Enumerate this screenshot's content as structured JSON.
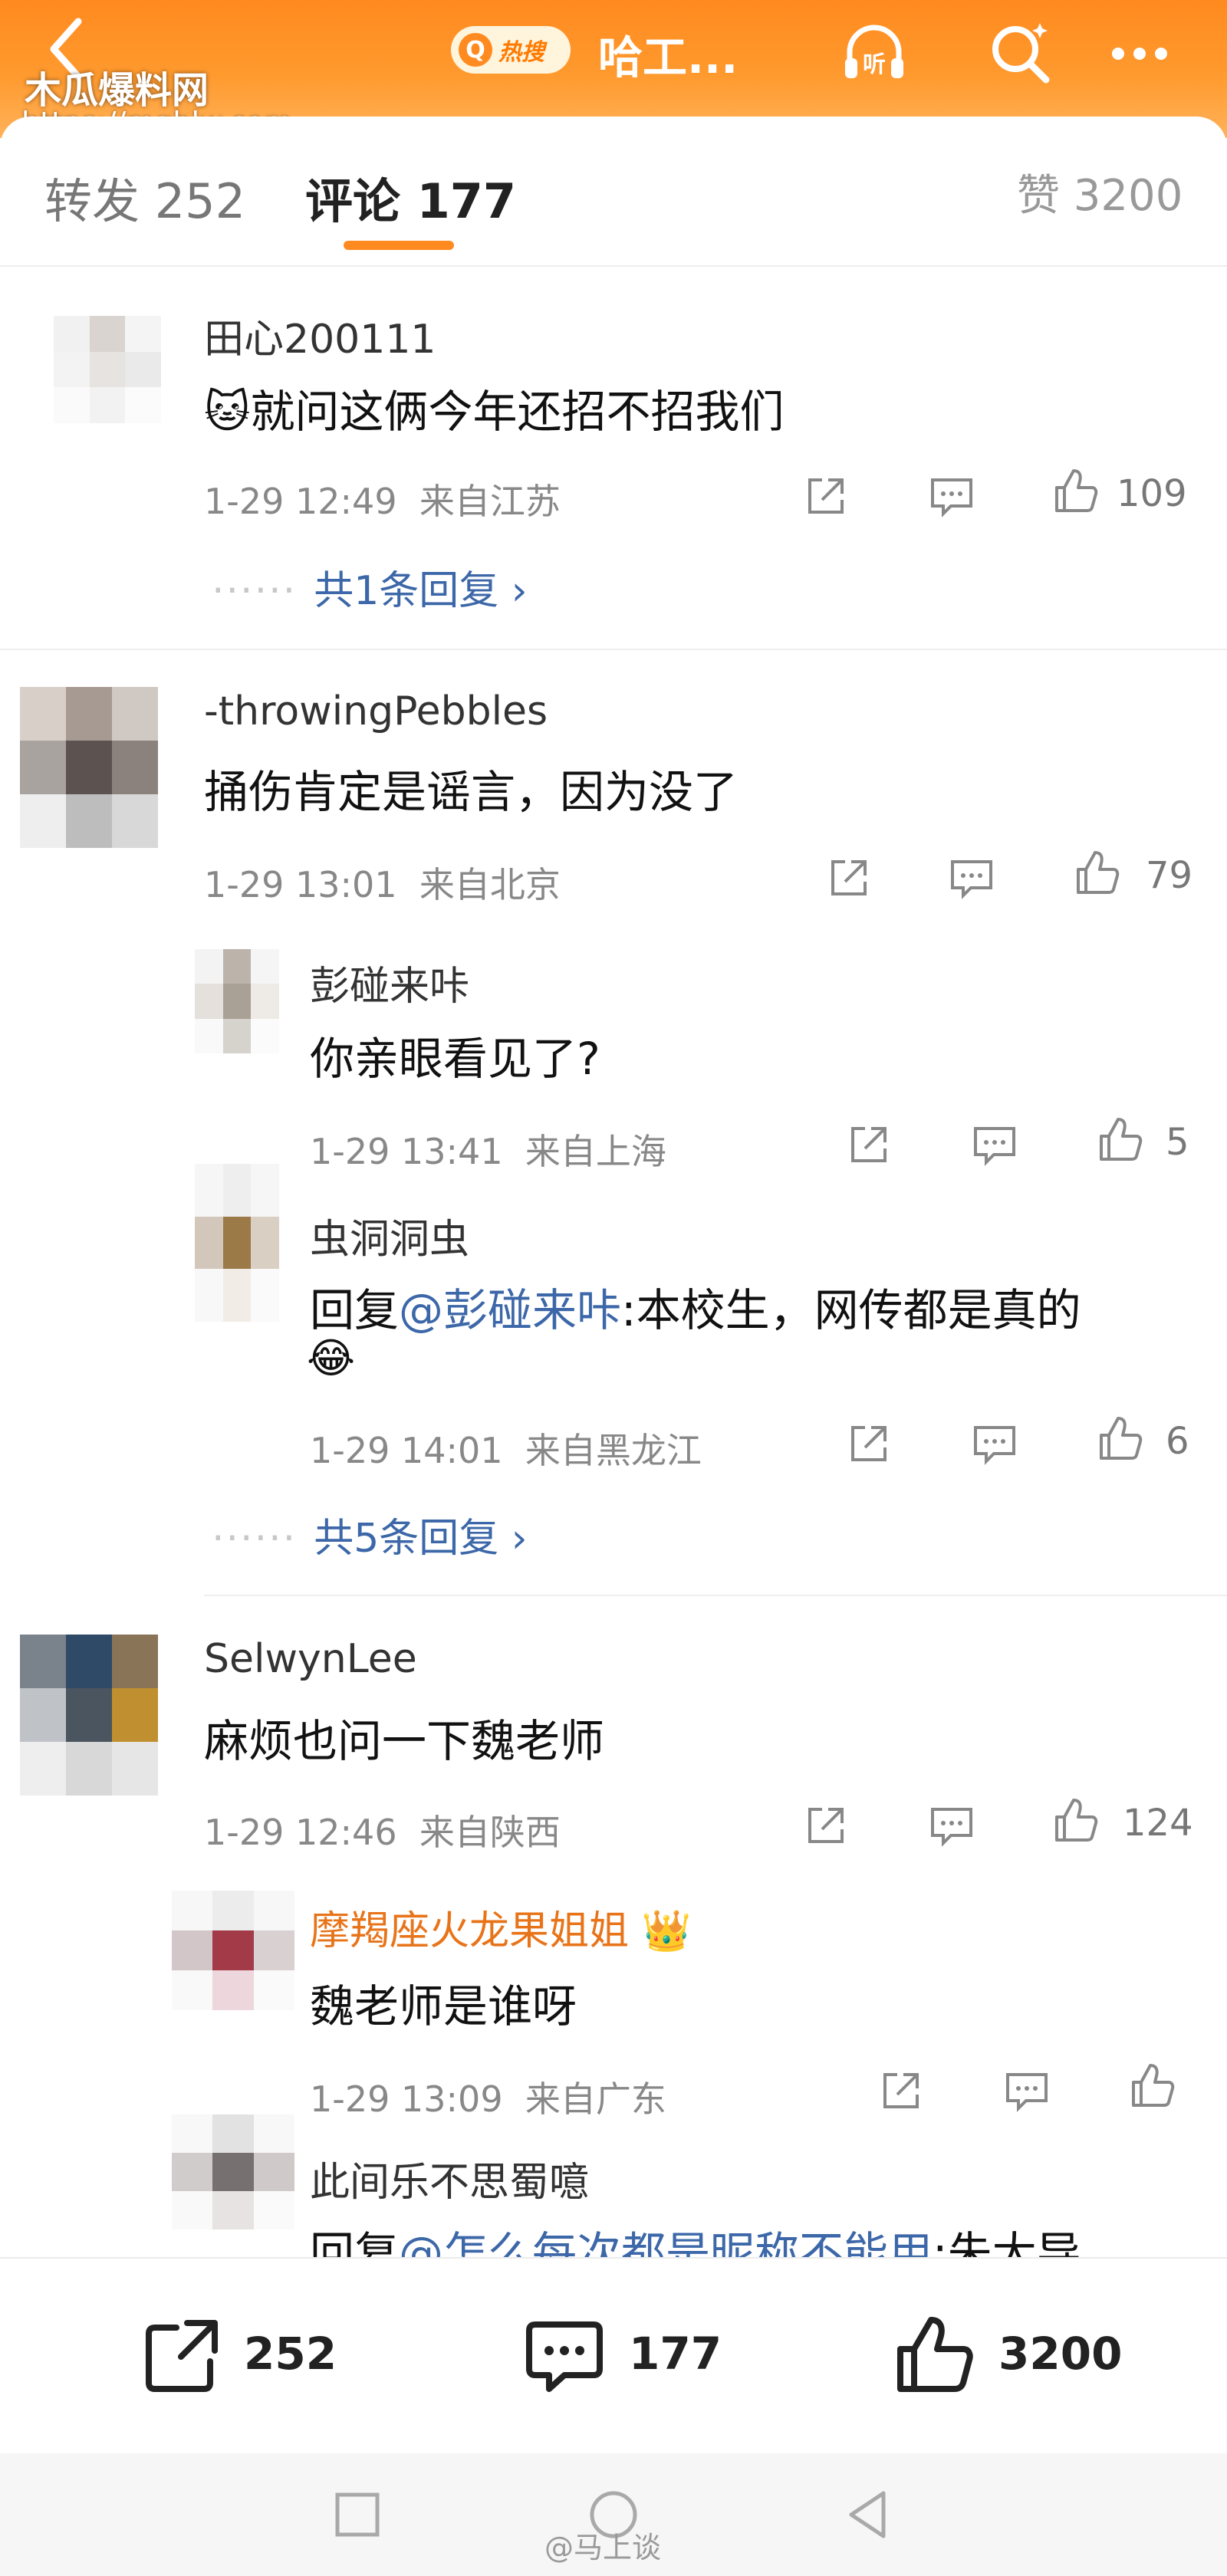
{
  "header": {
    "hot_badge": "热搜",
    "title": "哈工...",
    "watermark_name": "木瓜爆料网",
    "watermark_url": "https://mgblw.com"
  },
  "tabs": {
    "repost": "转发 252",
    "comments": "评论 177",
    "likes": "赞 3200"
  },
  "comments": [
    {
      "user": "田心200111",
      "text": "🐱就问这俩今年还招不招我们",
      "time": "1-29 12:49",
      "location": "来自江苏",
      "likes": "109",
      "more_replies": "共1条回复 ›"
    },
    {
      "user": "-throwingPebbles",
      "text": "捅伤肯定是谣言，因为没了",
      "time": "1-29 13:01",
      "location": "来自北京",
      "likes": "79",
      "more_replies": "共5条回复 ›",
      "replies": [
        {
          "user": "彭碰来咔",
          "text": "你亲眼看见了?",
          "time": "1-29 13:41",
          "location": "来自上海",
          "likes": "5"
        },
        {
          "user": "虫洞洞虫",
          "reply_prefix": "回复",
          "reply_to": "@彭碰来咔",
          "text": ":本校生，网传都是真的",
          "emoji": "😂",
          "time": "1-29 14:01",
          "location": "来自黑龙江",
          "likes": "6"
        }
      ]
    },
    {
      "user": "SelwynLee",
      "text": "麻烦也问一下魏老师",
      "time": "1-29 12:46",
      "location": "来自陕西",
      "likes": "124",
      "replies": [
        {
          "user": "摩羯座火龙果姐姐",
          "badge": "👑",
          "text": "魏老师是谁呀",
          "time": "1-29 13:09",
          "location": "来自广东",
          "likes": ""
        },
        {
          "user": "此间乐不思蜀噫",
          "reply_prefix": "回复",
          "reply_to": "@怎么每次都是昵称不能用",
          "text": ":朱大导"
        }
      ]
    }
  ],
  "bottom_bar": {
    "reposts": "252",
    "comments": "177",
    "likes": "3200"
  },
  "footer_watermark": "@马上谈",
  "colors": {
    "header_orange": "#ff8a1f",
    "link_blue": "#3c67a8",
    "vip_orange": "#e8741a"
  }
}
